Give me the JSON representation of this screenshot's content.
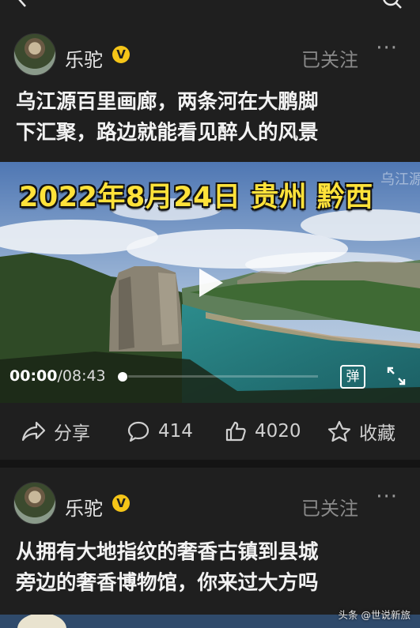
{
  "posts": [
    {
      "author": "乐驼",
      "verified_badge": "V",
      "follow_status": "已关注",
      "more": "···",
      "title_lines": [
        "乌江源百里画廊，两条河在大鹏脚",
        "下汇聚，路边就能看见醉人的风景"
      ],
      "video": {
        "overlay_text": "2022年8月24日 贵州 黔西",
        "watermark": "乌江源",
        "current_time": "00:00",
        "duration": "/08:43",
        "progress_fraction": 0,
        "danmu_label": "弹"
      },
      "actions": {
        "share_label": "分享",
        "comments": "414",
        "likes": "4020",
        "favorite_label": "收藏"
      }
    },
    {
      "author": "乐驼",
      "verified_badge": "V",
      "follow_status": "已关注",
      "more": "···",
      "title_lines": [
        "从拥有大地指纹的奢香古镇到县城",
        "旁边的奢香博物馆，你来过大方吗"
      ]
    }
  ],
  "credit": "头条 @世说新旅",
  "icons": [
    "back-arrow-icon",
    "search-icon",
    "play-icon",
    "fullscreen-icon",
    "share-icon",
    "comment-icon",
    "like-icon",
    "star-icon"
  ],
  "colors": {
    "background": "#1f1f1f",
    "badge": "#f5c518",
    "overlay_text": "#ffe23a"
  }
}
